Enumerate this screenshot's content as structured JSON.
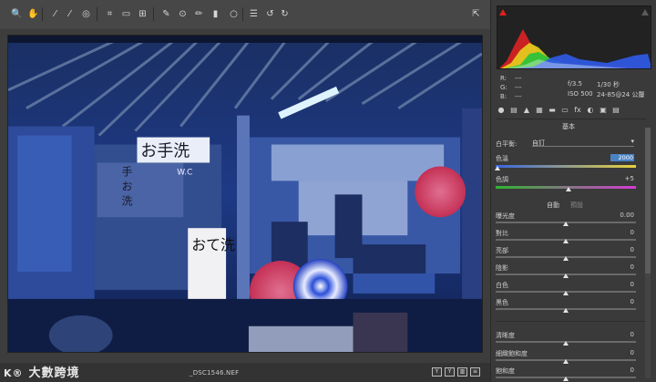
{
  "toolbar": {
    "tools": [
      {
        "icon": "zoom-icon",
        "glyph": "🔍"
      },
      {
        "icon": "hand-icon",
        "glyph": "✋"
      },
      {
        "icon": "white-balance-icon",
        "glyph": "⁄"
      },
      {
        "icon": "color-sampler-icon",
        "glyph": "⁄"
      },
      {
        "icon": "targeted-adjust-icon",
        "glyph": "◎"
      },
      {
        "icon": "crop-icon",
        "glyph": "⌗"
      },
      {
        "icon": "straighten-icon",
        "glyph": "▭"
      },
      {
        "icon": "transform-icon",
        "glyph": "⊞"
      },
      {
        "icon": "spot-removal-icon",
        "glyph": "✎"
      },
      {
        "icon": "red-eye-icon",
        "glyph": "⊙"
      },
      {
        "icon": "adjustment-brush-icon",
        "glyph": "✏"
      },
      {
        "icon": "graduated-filter-icon",
        "glyph": "▮"
      },
      {
        "icon": "radial-filter-icon",
        "glyph": "○"
      },
      {
        "icon": "preferences-icon",
        "glyph": "☰"
      },
      {
        "icon": "rotate-ccw-icon",
        "glyph": "↺"
      },
      {
        "icon": "rotate-cw-icon",
        "glyph": "↻"
      },
      {
        "icon": "toggle-fullscreen-icon",
        "glyph": "⇱"
      }
    ]
  },
  "preview": {
    "sign_text_1": "お手洗",
    "sign_text_2": "おて洗",
    "sign_side_1": "手",
    "sign_side_2": "お",
    "sign_side_3": "洗",
    "sign_wc": "W.C"
  },
  "statusbar": {
    "filename": "_DSC1546.NEF",
    "view_buttons": [
      "Y",
      "Y",
      "▥",
      "≡"
    ]
  },
  "watermark": {
    "logo": "K®",
    "text": "大數跨境"
  },
  "camera_info": {
    "r_label": "R:",
    "g_label": "G:",
    "b_label": "B:",
    "r_value": "---",
    "g_value": "---",
    "b_value": "---",
    "aperture": "f/3.5",
    "shutter": "1/30 秒",
    "iso": "ISO 500",
    "lens": "24-85@24 公釐"
  },
  "panel": {
    "title": "基本",
    "white_balance_label": "白平衡:",
    "white_balance_value": "自訂",
    "temperature_label": "色溫",
    "temperature_value": "2000",
    "tint_label": "色調",
    "tint_value": "+5",
    "auto_label": "自動",
    "default_label": "預設",
    "sliders": [
      {
        "label": "曝光度",
        "value": "0.00",
        "position": 0.5
      },
      {
        "label": "對比",
        "value": "0",
        "position": 0.5
      },
      {
        "label": "亮部",
        "value": "0",
        "position": 0.5
      },
      {
        "label": "陰影",
        "value": "0",
        "position": 0.5
      },
      {
        "label": "白色",
        "value": "0",
        "position": 0.5
      },
      {
        "label": "黑色",
        "value": "0",
        "position": 0.5
      }
    ],
    "presence_sliders": [
      {
        "label": "清晰度",
        "value": "0",
        "position": 0.5
      },
      {
        "label": "細緻飽和度",
        "value": "0",
        "position": 0.5
      },
      {
        "label": "飽和度",
        "value": "0",
        "position": 0.5
      }
    ],
    "temperature_position": 0.01,
    "tint_position": 0.52
  },
  "panel_tabs": [
    "basic-icon",
    "tone-curve-icon",
    "detail-icon",
    "hsl-icon",
    "split-toning-icon",
    "lens-corrections-icon",
    "effects-icon",
    "camera-calibration-icon",
    "presets-icon",
    "snapshots-icon"
  ]
}
